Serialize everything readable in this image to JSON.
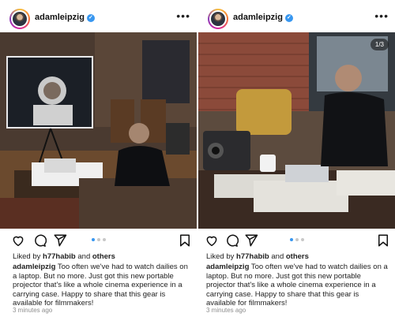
{
  "posts": [
    {
      "username": "adamleipzig",
      "verified": true,
      "liked_by_prefix": "Liked by",
      "liked_by_user": "h77habib",
      "liked_by_and": "and",
      "liked_by_others": "others",
      "caption_text": "Too often we've had to watch dailies on a laptop. But no more. Just got this new portable projector that's like a whole cinema experience in a carrying case. Happy to share that this gear is available for filmmakers!",
      "time": "3 minutes ago",
      "carousel_active_index": 1,
      "carousel_count": 3
    },
    {
      "username": "adamleipzig",
      "verified": true,
      "image_counter": "1/3",
      "liked_by_prefix": "Liked by",
      "liked_by_user": "h77habib",
      "liked_by_and": "and",
      "liked_by_others": "others",
      "caption_text": "Too often we've had to watch dailies on a laptop. But no more. Just got this new portable projector that's like a whole cinema experience in a carrying case. Happy to share that this gear is available for filmmakers!",
      "time": "3 minutes ago",
      "carousel_active_index": 1,
      "carousel_count": 3
    }
  ],
  "icons": {
    "more": "more-options-icon",
    "like": "heart-icon",
    "comment": "comment-icon",
    "share": "share-icon",
    "save": "bookmark-icon"
  },
  "colors": {
    "verified": "#3897f0",
    "dot_active": "#3897f0",
    "dot_inactive": "#c8c8c8",
    "timestamp": "#8e8e8e"
  }
}
